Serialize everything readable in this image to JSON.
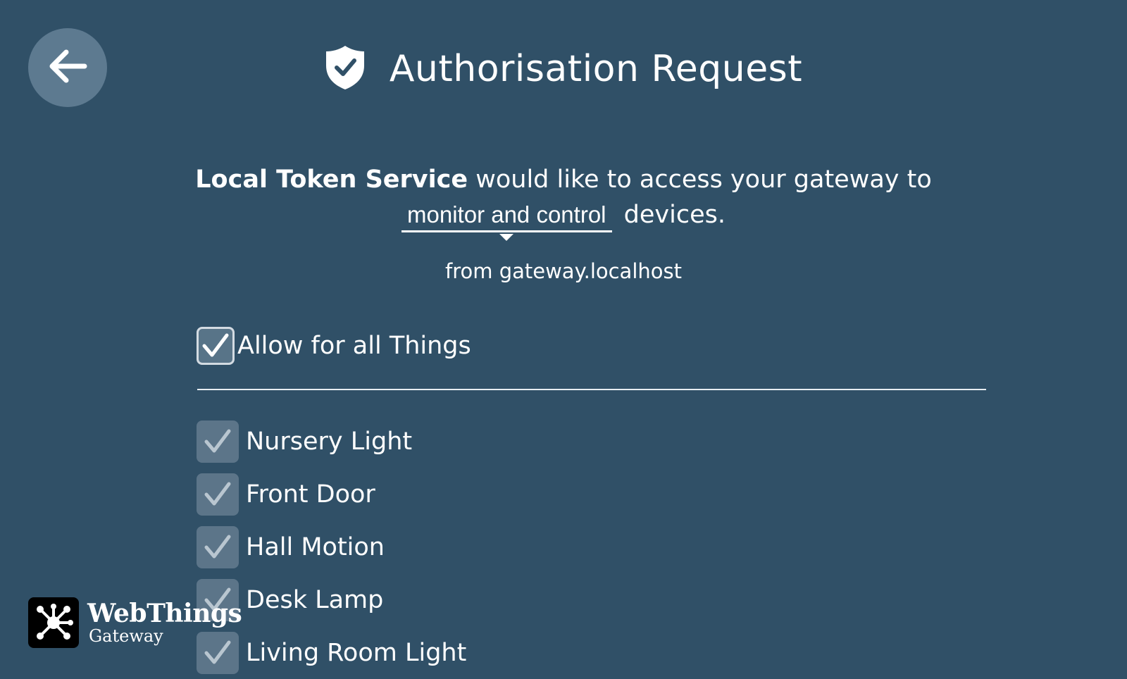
{
  "header": {
    "back_icon": "arrow-left-icon",
    "shield_icon": "shield-check-icon",
    "title": "Authorisation Request"
  },
  "request": {
    "app_name": "Local Token Service",
    "message_part1": " would like to access your gateway to",
    "scope": "monitor and control",
    "message_part2": "devices.",
    "origin": "from gateway.localhost"
  },
  "allow_all": {
    "label": "Allow for all Things",
    "checked": true
  },
  "things": [
    {
      "label": "Nursery Light",
      "checked": true
    },
    {
      "label": "Front Door",
      "checked": true
    },
    {
      "label": "Hall Motion",
      "checked": true
    },
    {
      "label": "Desk Lamp",
      "checked": true
    },
    {
      "label": "Living Room Light",
      "checked": true
    }
  ],
  "brand": {
    "name": "WebThings",
    "subtitle": "Gateway",
    "logo_icon": "webthings-logo-icon"
  },
  "colors": {
    "background": "#305067",
    "back_button": "#5d7a90",
    "disabled_checkbox": "#5c7589"
  }
}
